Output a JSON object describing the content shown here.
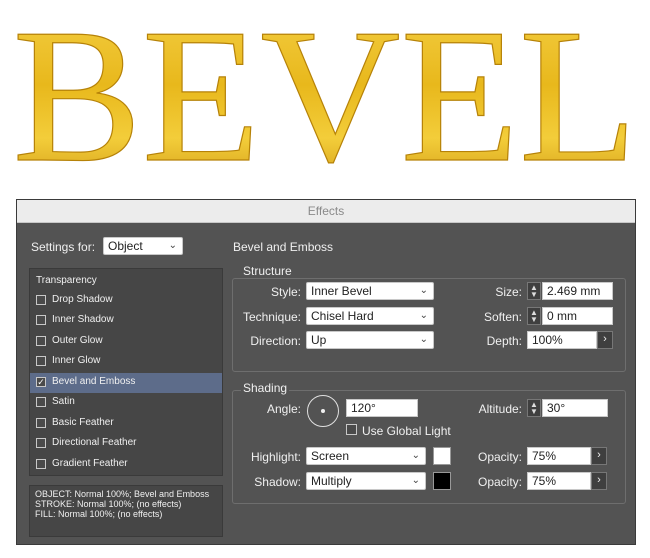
{
  "banner": {
    "text": "BEVEL"
  },
  "dialog": {
    "title": "Effects",
    "settings_for": {
      "label": "Settings for:",
      "value": "Object"
    },
    "section_title": "Bevel and Emboss",
    "effects_list": {
      "header": "Transparency",
      "items": [
        {
          "label": "Drop Shadow",
          "checked": false,
          "selected": false
        },
        {
          "label": "Inner Shadow",
          "checked": false,
          "selected": false
        },
        {
          "label": "Outer Glow",
          "checked": false,
          "selected": false
        },
        {
          "label": "Inner Glow",
          "checked": false,
          "selected": false
        },
        {
          "label": "Bevel and Emboss",
          "checked": true,
          "selected": true
        },
        {
          "label": "Satin",
          "checked": false,
          "selected": false
        },
        {
          "label": "Basic Feather",
          "checked": false,
          "selected": false
        },
        {
          "label": "Directional Feather",
          "checked": false,
          "selected": false
        },
        {
          "label": "Gradient Feather",
          "checked": false,
          "selected": false
        }
      ],
      "check_mark": "✓"
    },
    "summary": {
      "line1": "OBJECT: Normal 100%; Bevel and Emboss",
      "line2": "STROKE: Normal 100%; (no effects)",
      "line3": "FILL: Normal 100%; (no effects)"
    },
    "structure": {
      "title": "Structure",
      "style": {
        "label": "Style:",
        "value": "Inner Bevel"
      },
      "technique": {
        "label": "Technique:",
        "value": "Chisel Hard"
      },
      "direction": {
        "label": "Direction:",
        "value": "Up"
      },
      "size": {
        "label": "Size:",
        "value": "2.469 mm"
      },
      "soften": {
        "label": "Soften:",
        "value": "0 mm"
      },
      "depth": {
        "label": "Depth:",
        "value": "100%"
      }
    },
    "shading": {
      "title": "Shading",
      "angle": {
        "label": "Angle:",
        "value": "120°"
      },
      "use_global_light": {
        "label": "Use Global Light",
        "checked": false
      },
      "altitude": {
        "label": "Altitude:",
        "value": "30°"
      },
      "highlight": {
        "label": "Highlight:",
        "value": "Screen",
        "color": "#ffffff"
      },
      "shadow": {
        "label": "Shadow:",
        "value": "Multiply",
        "color": "#000000"
      },
      "highlight_opacity": {
        "label": "Opacity:",
        "value": "75%"
      },
      "shadow_opacity": {
        "label": "Opacity:",
        "value": "75%"
      }
    },
    "icons": {
      "dropdown": "chevron-down-icon",
      "spinner": "up-down-arrows-icon",
      "submenu": "chevron-right-icon"
    }
  }
}
